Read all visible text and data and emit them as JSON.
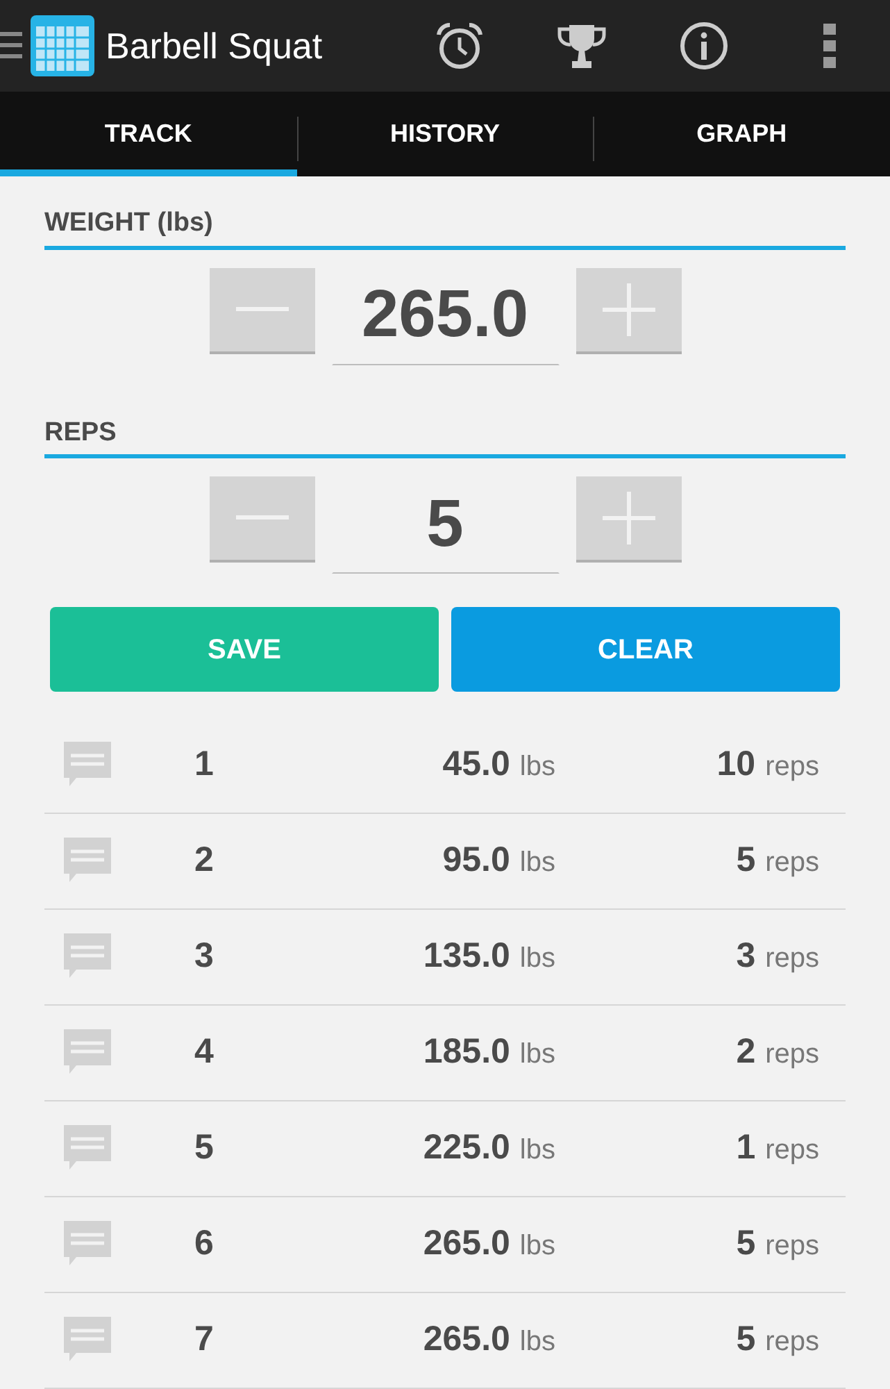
{
  "action_bar": {
    "title": "Barbell Squat"
  },
  "tabs": [
    {
      "label": "TRACK",
      "selected": true
    },
    {
      "label": "HISTORY",
      "selected": false
    },
    {
      "label": "GRAPH",
      "selected": false
    }
  ],
  "weight": {
    "label": "WEIGHT (lbs)",
    "value": "265.0"
  },
  "reps": {
    "label": "REPS",
    "value": "5"
  },
  "buttons": [
    {
      "label": "SAVE",
      "kind": "save"
    },
    {
      "label": "CLEAR",
      "kind": "clear"
    }
  ],
  "sets": [
    {
      "number": "1",
      "weight": "45.0",
      "weight_unit": "lbs",
      "reps": "10",
      "reps_unit": "reps"
    },
    {
      "number": "2",
      "weight": "95.0",
      "weight_unit": "lbs",
      "reps": "5",
      "reps_unit": "reps"
    },
    {
      "number": "3",
      "weight": "135.0",
      "weight_unit": "lbs",
      "reps": "3",
      "reps_unit": "reps"
    },
    {
      "number": "4",
      "weight": "185.0",
      "weight_unit": "lbs",
      "reps": "2",
      "reps_unit": "reps"
    },
    {
      "number": "5",
      "weight": "225.0",
      "weight_unit": "lbs",
      "reps": "1",
      "reps_unit": "reps"
    },
    {
      "number": "6",
      "weight": "265.0",
      "weight_unit": "lbs",
      "reps": "5",
      "reps_unit": "reps"
    },
    {
      "number": "7",
      "weight": "265.0",
      "weight_unit": "lbs",
      "reps": "5",
      "reps_unit": "reps"
    }
  ]
}
